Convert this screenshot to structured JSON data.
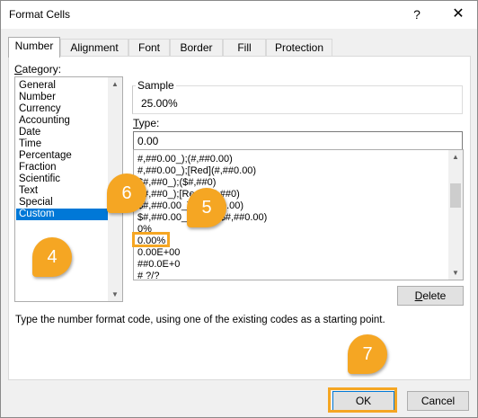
{
  "window": {
    "title": "Format Cells",
    "help_glyph": "?",
    "close_glyph": "✕"
  },
  "tabs": [
    {
      "label": "Number",
      "active": true
    },
    {
      "label": "Alignment"
    },
    {
      "label": "Font"
    },
    {
      "label": "Border"
    },
    {
      "label": "Fill"
    },
    {
      "label": "Protection"
    }
  ],
  "category": {
    "label_underlined": "C",
    "label_rest": "ategory:",
    "items": [
      "General",
      "Number",
      "Currency",
      "Accounting",
      "Date",
      "Time",
      "Percentage",
      "Fraction",
      "Scientific",
      "Text",
      "Special",
      "Custom"
    ],
    "selected": "Custom"
  },
  "sample": {
    "label": "Sample",
    "value": "25.00%"
  },
  "type": {
    "label_underlined": "T",
    "label_rest": "ype:",
    "value": "0.00"
  },
  "format_list": {
    "items": [
      "#,##0.00_);(#,##0.00)",
      "#,##0.00_);[Red](#,##0.00)",
      "$#,##0_);($#,##0)",
      "$#,##0_);[Red]($#,##0)",
      "$#,##0.00_);($#,##0.00)",
      "$#,##0.00_);[Red]($#,##0.00)",
      "0%",
      "0.00%",
      "0.00E+00",
      "##0.0E+0",
      "# ?/?"
    ],
    "visible_parts": [
      "#,##0.00_);(#,##0.00)",
      "#,##0.00_);[Red](#,##0.00)",
      "$#,##0_);($#,##0)",
      "$#,##0_);[Red]($#,##0)",
      "$#,##0.00_);($#,##0.00)",
      "$#,##0.00_);[Red]($#,##0.00)",
      "0%",
      "0.00%",
      "0.00E+00",
      "##0.0E+0",
      "# ?/?"
    ]
  },
  "delete_button": {
    "label_underlined": "D",
    "label_rest": "elete"
  },
  "help_text": "Type the number format code, using one of the existing codes as a starting point.",
  "buttons": {
    "ok": "OK",
    "cancel": "Cancel"
  },
  "callouts": [
    "4",
    "5",
    "6",
    "7"
  ],
  "colors": {
    "accent": "#f5a623",
    "selection": "#0078d7"
  }
}
